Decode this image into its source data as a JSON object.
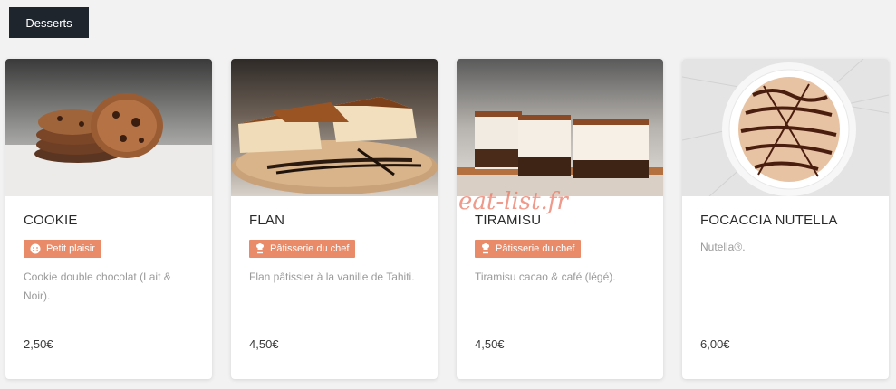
{
  "category": {
    "label": "Desserts"
  },
  "watermark": "eat-list.fr",
  "products": [
    {
      "title": "COOKIE",
      "badge": {
        "label": "Petit plaisir",
        "icon": "smiley-icon"
      },
      "description": "Cookie double chocolat (Lait & Noir).",
      "price": "2,50€"
    },
    {
      "title": "FLAN",
      "badge": {
        "label": "Pâtisserie du chef",
        "icon": "chef-icon"
      },
      "description": "Flan pâtissier à la vanille de Tahiti.",
      "price": "4,50€"
    },
    {
      "title": "TIRAMISU",
      "badge": {
        "label": "Pâtisserie du chef",
        "icon": "chef-icon"
      },
      "description": "Tiramisu cacao & café (légé).",
      "price": "4,50€"
    },
    {
      "title": "FOCACCIA NUTELLA",
      "description": "Nutella®.",
      "price": "6,00€"
    }
  ],
  "colors": {
    "badge": "#e98b68",
    "tab_bg": "#1f252d",
    "watermark": "#e97864"
  }
}
